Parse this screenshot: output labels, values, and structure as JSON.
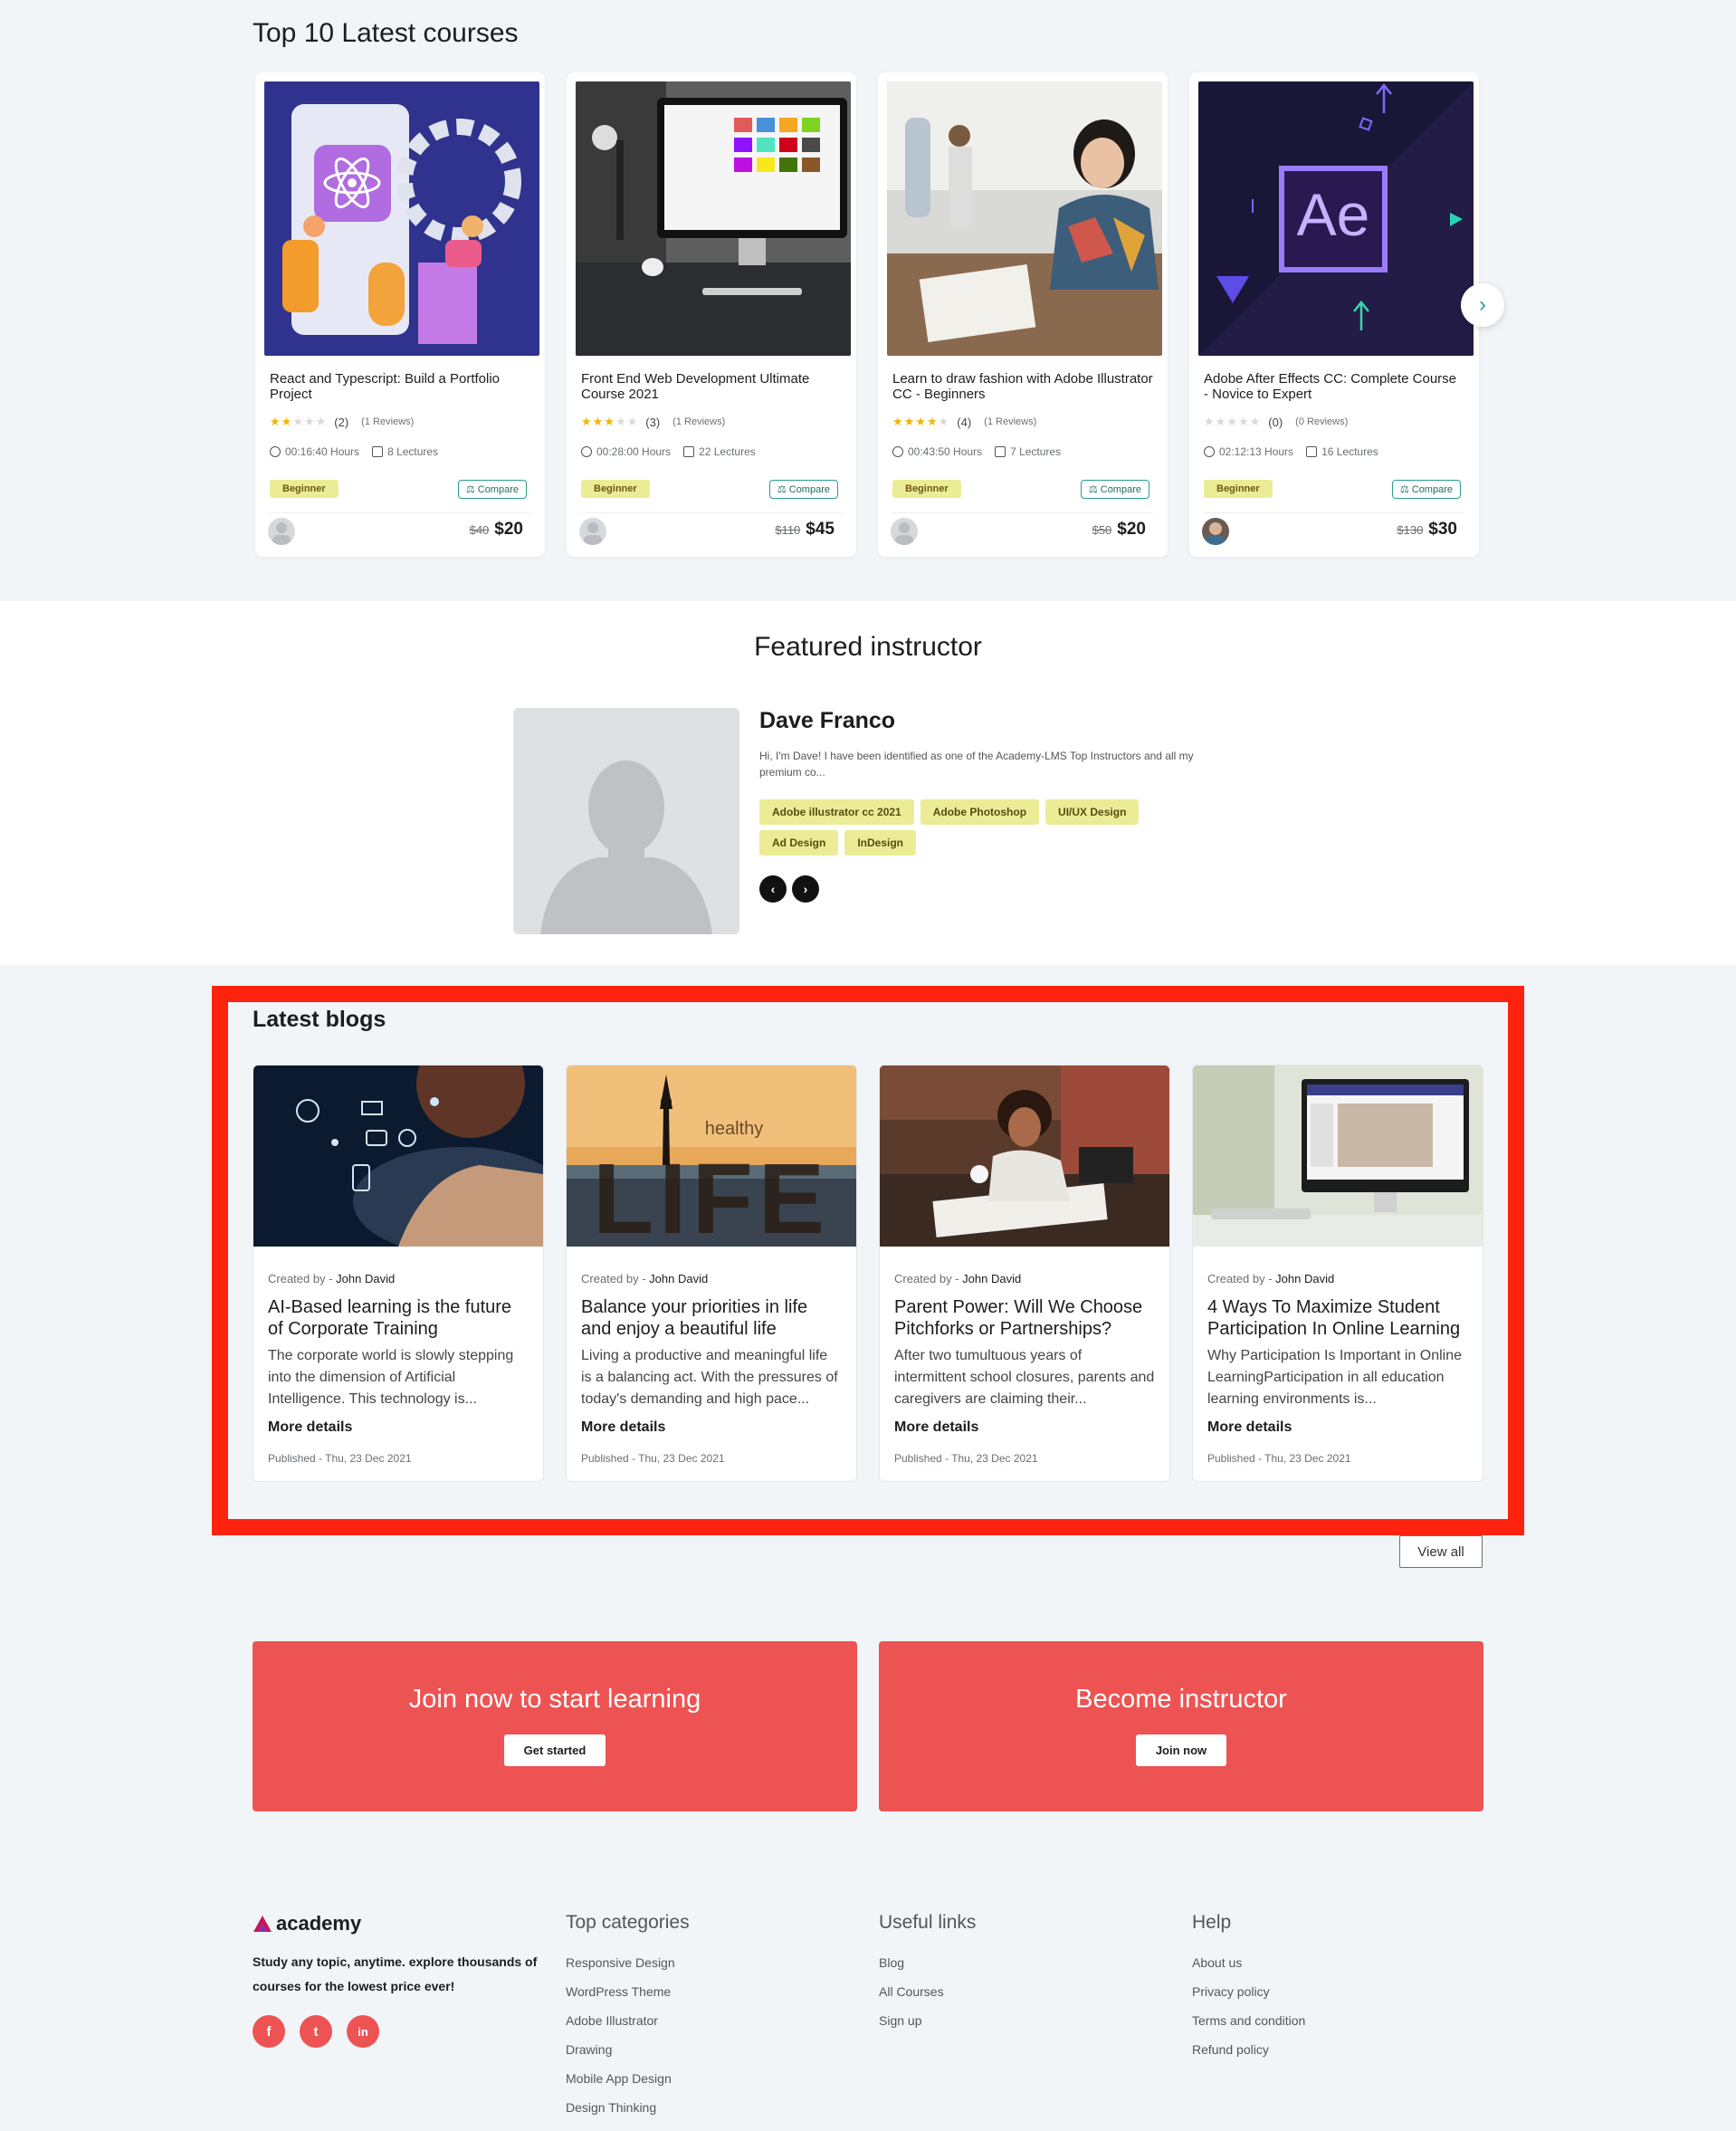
{
  "courses": {
    "title": "Top 10 Latest courses",
    "items": [
      {
        "title": "React and Typescript: Build a Portfolio Project",
        "stars": 2,
        "rating_count": "(2)",
        "reviews": "(1 Reviews)",
        "duration": "00:16:40 Hours",
        "lectures": "8 Lectures",
        "level": "Beginner",
        "compare": "Compare",
        "old_price": "$40",
        "price": "$20"
      },
      {
        "title": "Front End Web Development Ultimate Course 2021",
        "stars": 3,
        "rating_count": "(3)",
        "reviews": "(1 Reviews)",
        "duration": "00:28:00 Hours",
        "lectures": "22 Lectures",
        "level": "Beginner",
        "compare": "Compare",
        "old_price": "$110",
        "price": "$45"
      },
      {
        "title": "Learn to draw fashion with Adobe Illustrator CC - Beginners",
        "stars": 4,
        "rating_count": "(4)",
        "reviews": "(1 Reviews)",
        "duration": "00:43:50 Hours",
        "lectures": "7 Lectures",
        "level": "Beginner",
        "compare": "Compare",
        "old_price": "$50",
        "price": "$20"
      },
      {
        "title": "Adobe After Effects CC: Complete Course - Novice to Expert",
        "stars": 0,
        "rating_count": "(0)",
        "reviews": "(0 Reviews)",
        "duration": "02:12:13 Hours",
        "lectures": "16 Lectures",
        "level": "Beginner",
        "compare": "Compare",
        "old_price": "$130",
        "price": "$30"
      }
    ]
  },
  "instructor": {
    "title": "Featured instructor",
    "name": "Dave Franco",
    "bio": "Hi, I'm Dave! I have been identified as one of the Academy-LMS Top Instructors and all my premium co...",
    "tags": [
      "Adobe illustrator cc 2021",
      "Adobe Photoshop",
      "UI/UX Design",
      "Ad Design",
      "InDesign"
    ]
  },
  "blogs": {
    "title": "Latest blogs",
    "created_by_prefix": "Created by - ",
    "more": "More details",
    "view_all": "View all",
    "items": [
      {
        "author": "John David",
        "title": "AI-Based learning is the future of Corporate Training",
        "excerpt": "The corporate world is slowly stepping into the dimension of Artificial Intelligence. This technology is...",
        "published": "Published - Thu, 23 Dec 2021"
      },
      {
        "author": "John David",
        "title": "Balance your priorities in life and enjoy a beautiful life",
        "excerpt": "Living a productive and meaningful life is a balancing act. With the pressures of today's demanding and high pace...",
        "published": "Published - Thu, 23 Dec 2021",
        "image_text_small": "healthy",
        "image_text_big": "LIFE"
      },
      {
        "author": "John David",
        "title": "Parent Power: Will We Choose Pitchforks or Partnerships?",
        "excerpt": "After two tumultuous years of intermittent school closures, parents and caregivers are claiming their...",
        "published": "Published - Thu, 23 Dec 2021"
      },
      {
        "author": "John David",
        "title": "4 Ways To Maximize Student Participation In Online Learning",
        "excerpt": "Why Participation Is Important in Online LearningParticipation in all education learning environments is...",
        "published": "Published - Thu, 23 Dec 2021"
      }
    ]
  },
  "cta": {
    "join_title": "Join now to start learning",
    "join_button": "Get started",
    "instructor_title": "Become instructor",
    "instructor_button": "Join now"
  },
  "footer": {
    "logo": "academy",
    "tagline": "Study any topic, anytime. explore thousands of courses for the lowest price ever!",
    "socials": [
      "f",
      "t",
      "in"
    ],
    "top_categories": {
      "title": "Top categories",
      "links": [
        "Responsive Design",
        "WordPress Theme",
        "Adobe Illustrator",
        "Drawing",
        "Mobile App Design",
        "Design Thinking"
      ]
    },
    "useful_links": {
      "title": "Useful links",
      "links": [
        "Blog",
        "All Courses",
        "Sign up"
      ]
    },
    "help": {
      "title": "Help",
      "links": [
        "About us",
        "Privacy policy",
        "Terms and condition",
        "Refund policy"
      ]
    }
  },
  "colors": {
    "accent": "#ee5353",
    "highlight": "#ff230f",
    "tag_bg": "#ecec96",
    "teal": "#2a9d8f"
  }
}
